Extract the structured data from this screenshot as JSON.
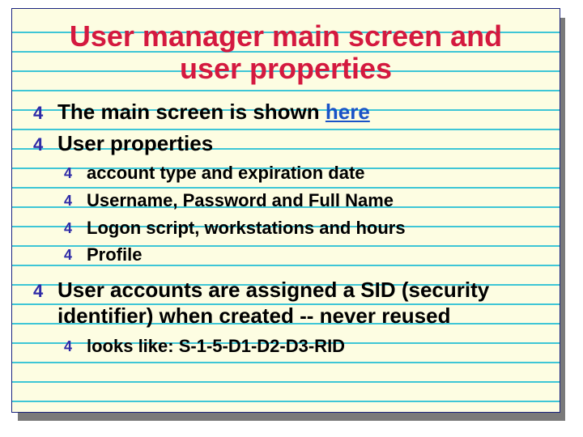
{
  "title": "User manager main screen and user properties",
  "bullet_glyph": "4",
  "items": [
    {
      "pre": "The main screen is shown ",
      "link": "here"
    },
    {
      "text": "User properties"
    }
  ],
  "subitems": [
    {
      "text": "account type and expiration date"
    },
    {
      "text": "Username, Password and Full Name"
    },
    {
      "text": "Logon script, workstations and hours"
    },
    {
      "text": "Profile"
    }
  ],
  "items2": [
    {
      "text": "User accounts are assigned a SID (security identifier) when created -- never reused"
    }
  ],
  "subitems2": [
    {
      "text": "looks like: S-1-5-D1-D2-D3-RID"
    }
  ]
}
